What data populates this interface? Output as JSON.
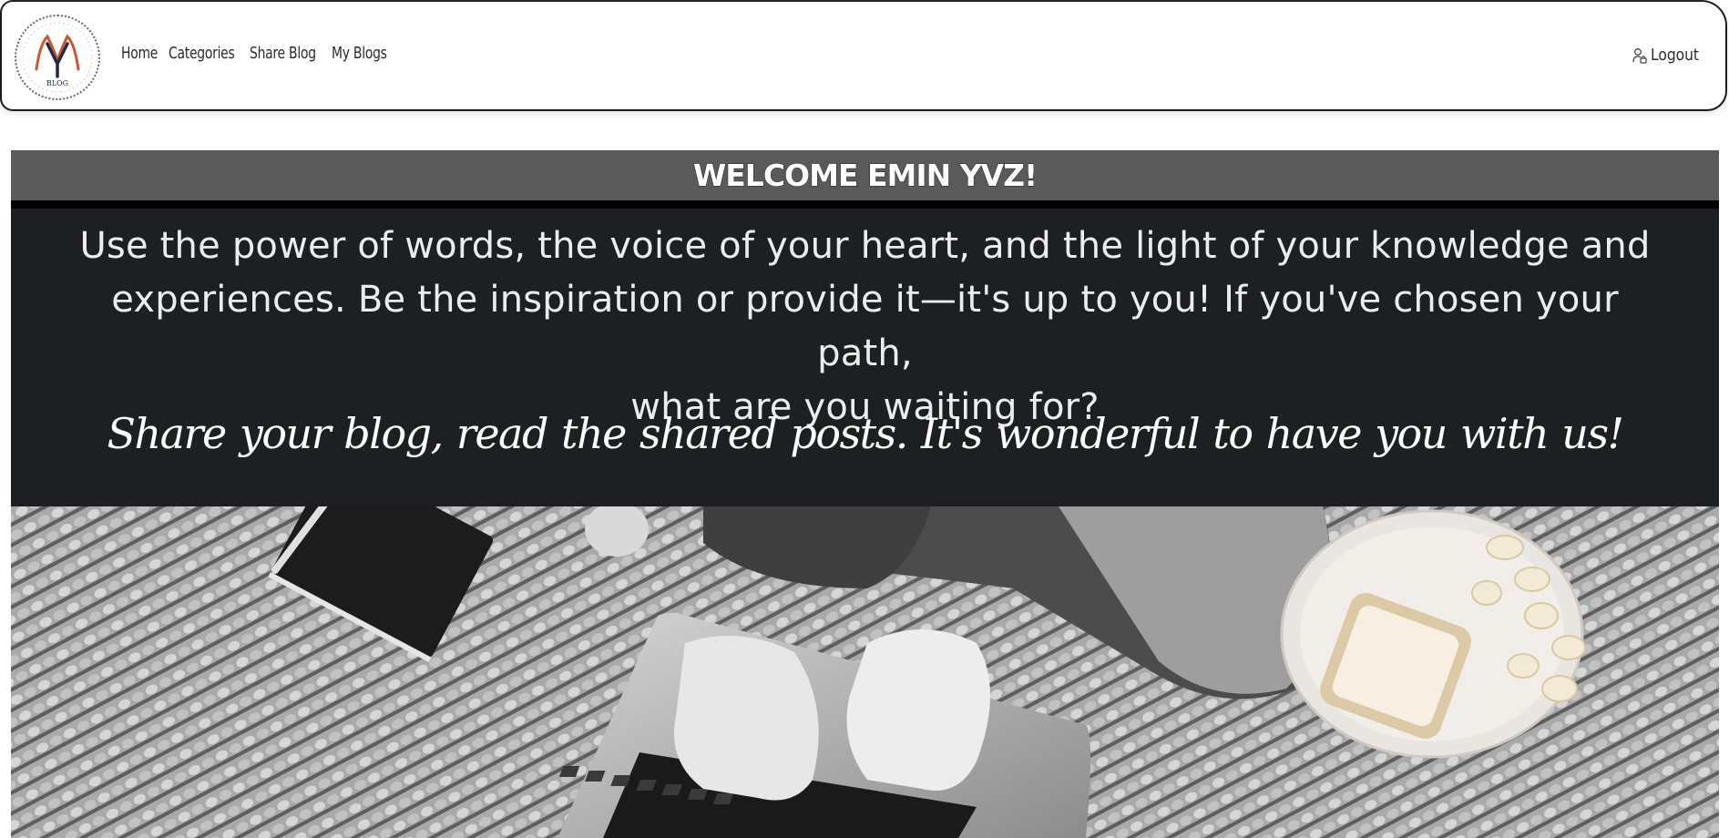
{
  "nav": {
    "logo": {
      "letters": "MY",
      "caption": "BLOG"
    },
    "links": [
      {
        "label": "Home"
      },
      {
        "label": "Categories"
      },
      {
        "label": "Share Blog"
      },
      {
        "label": "My Blogs"
      }
    ],
    "logout": {
      "label": "Logout",
      "icon": "user-lock-icon"
    }
  },
  "welcome": {
    "heading": "WELCOME EMIN YVZ!"
  },
  "intro": {
    "line_1": "Use the power of words, the voice of your heart, and the light of your knowledge and",
    "line_2": "experiences. Be the inspiration or provide it—it's up to you! If you've chosen your path,",
    "line_3": "what are you waiting for?",
    "tagline": "Share your blog, read the shared posts.  It's wonderful to have you with us!"
  },
  "hero": {
    "photo": "person-typing-on-laptop-photo"
  },
  "colors": {
    "nav_text": "#2b2b2b",
    "welcome_bg": "#5a5a5a",
    "intro_bg": "#1e1f22",
    "logo_accent": "#d0562a",
    "logo_dark": "#1f2a4a"
  }
}
